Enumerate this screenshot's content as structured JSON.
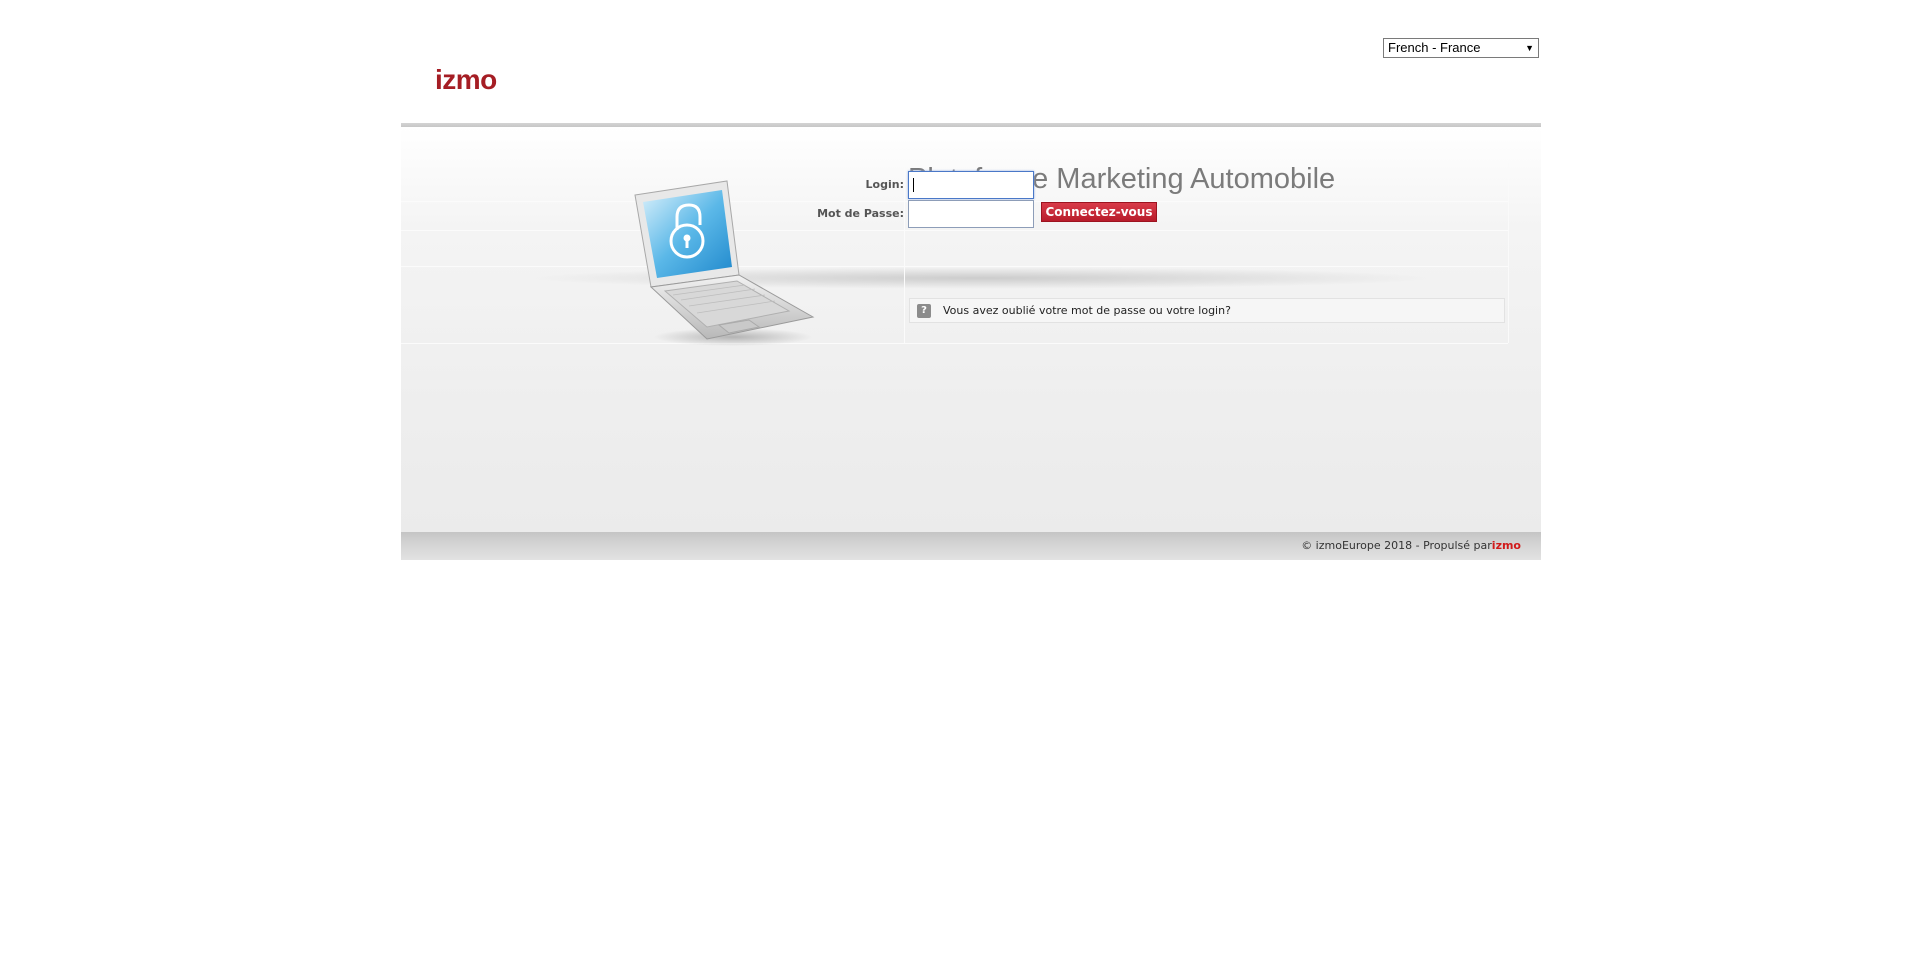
{
  "language_select": {
    "value": "French - France"
  },
  "logo": {
    "text": "izmo"
  },
  "page": {
    "title": "Plateforme Marketing Automobile"
  },
  "login_form": {
    "login_label": "Login:",
    "login_value": "",
    "password_label": "Mot de Passe:",
    "password_value": "",
    "submit_label": "Connectez-vous",
    "forgot_text": "Vous avez oublié votre mot de passe ou votre login?"
  },
  "footer": {
    "copyright": "© izmoEurope 2018 - Propulsé par",
    "brand": "izmo"
  },
  "colors": {
    "brand_red": "#a51d24",
    "button_red": "#c8283a"
  },
  "icons": [
    "dropdown-arrow-icon",
    "laptop-padlock-icon",
    "help-question-icon"
  ]
}
